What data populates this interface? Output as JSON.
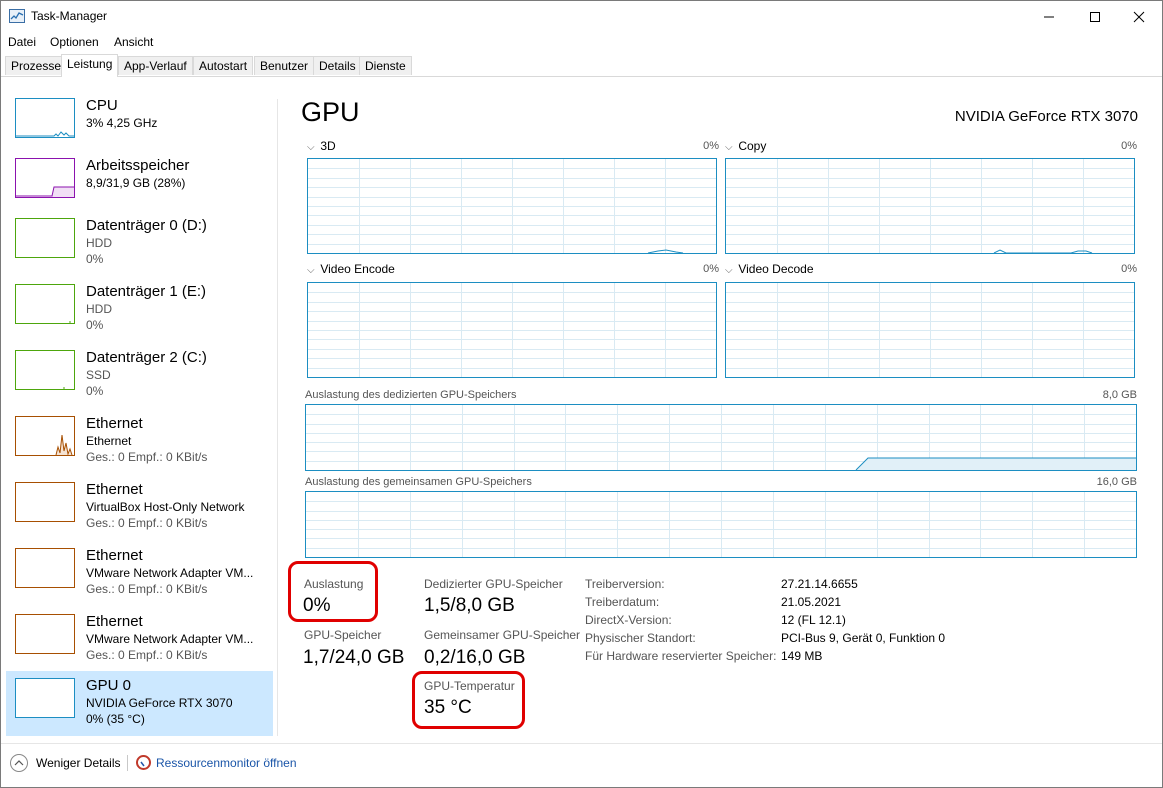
{
  "window": {
    "title": "Task-Manager"
  },
  "menu": [
    "Datei",
    "Optionen",
    "Ansicht"
  ],
  "tabs": [
    {
      "label": "Prozesse",
      "active": false
    },
    {
      "label": "Leistung",
      "active": true
    },
    {
      "label": "App-Verlauf",
      "active": false
    },
    {
      "label": "Autostart",
      "active": false
    },
    {
      "label": "Benutzer",
      "active": false
    },
    {
      "label": "Details",
      "active": false
    },
    {
      "label": "Dienste",
      "active": false
    }
  ],
  "sidebar": {
    "items": [
      {
        "title": "CPU",
        "line1": "3% 4,25 GHz",
        "line2": "",
        "color": "#1c8ec2"
      },
      {
        "title": "Arbeitsspeicher",
        "line1": "8,9/31,9 GB (28%)",
        "line2": "",
        "color": "#8b12ae"
      },
      {
        "title": "Datenträger 0 (D:)",
        "line1": "HDD",
        "line2": "0%",
        "color": "#4da60c"
      },
      {
        "title": "Datenträger 1 (E:)",
        "line1": "HDD",
        "line2": "0%",
        "color": "#4da60c"
      },
      {
        "title": "Datenträger 2 (C:)",
        "line1": "SSD",
        "line2": "0%",
        "color": "#4da60c"
      },
      {
        "title": "Ethernet",
        "line1": "Ethernet",
        "line2": "Ges.: 0 Empf.: 0 KBit/s",
        "color": "#a74f01"
      },
      {
        "title": "Ethernet",
        "line1": "VirtualBox Host-Only Network",
        "line2": "Ges.: 0 Empf.: 0 KBit/s",
        "color": "#a74f01"
      },
      {
        "title": "Ethernet",
        "line1": "VMware Network Adapter VM...",
        "line2": "Ges.: 0 Empf.: 0 KBit/s",
        "color": "#a74f01"
      },
      {
        "title": "Ethernet",
        "line1": "VMware Network Adapter VM...",
        "line2": "Ges.: 0 Empf.: 0 KBit/s",
        "color": "#a74f01"
      },
      {
        "title": "GPU 0",
        "line1": "NVIDIA GeForce RTX 3070",
        "line2": "0% (35 °C)",
        "color": "#1c8ec2"
      }
    ]
  },
  "main": {
    "title": "GPU",
    "model": "NVIDIA GeForce RTX 3070",
    "engines": [
      {
        "label": "3D",
        "pct": "0%"
      },
      {
        "label": "Copy",
        "pct": "0%"
      },
      {
        "label": "Video Encode",
        "pct": "0%"
      },
      {
        "label": "Video Decode",
        "pct": "0%"
      }
    ],
    "dedicated_mem": {
      "label": "Auslastung des dedizierten GPU-Speichers",
      "max": "8,0 GB"
    },
    "shared_mem": {
      "label": "Auslastung des gemeinsamen GPU-Speichers",
      "max": "16,0 GB"
    },
    "stats": {
      "utilization_label": "Auslastung",
      "utilization_value": "0%",
      "gpu_mem_label": "GPU-Speicher",
      "gpu_mem_value": "1,7/24,0 GB",
      "dedicated_label": "Dedizierter GPU-Speicher",
      "dedicated_value": "1,5/8,0 GB",
      "shared_label": "Gemeinsamer GPU-Speicher",
      "shared_value": "0,2/16,0 GB",
      "temp_label": "GPU-Temperatur",
      "temp_value": "35 °C"
    },
    "info": [
      {
        "key": "Treiberversion:",
        "value": "27.21.14.6655"
      },
      {
        "key": "Treiberdatum:",
        "value": "21.05.2021"
      },
      {
        "key": "DirectX-Version:",
        "value": "12 (FL 12.1)"
      },
      {
        "key": "Physischer Standort:",
        "value": "PCI-Bus 9, Gerät 0, Funktion 0"
      },
      {
        "key": "Für Hardware reservierter Speicher:",
        "value": "149 MB"
      }
    ]
  },
  "footer": {
    "less_details": "Weniger Details",
    "resource_monitor": "Ressourcenmonitor öffnen"
  }
}
